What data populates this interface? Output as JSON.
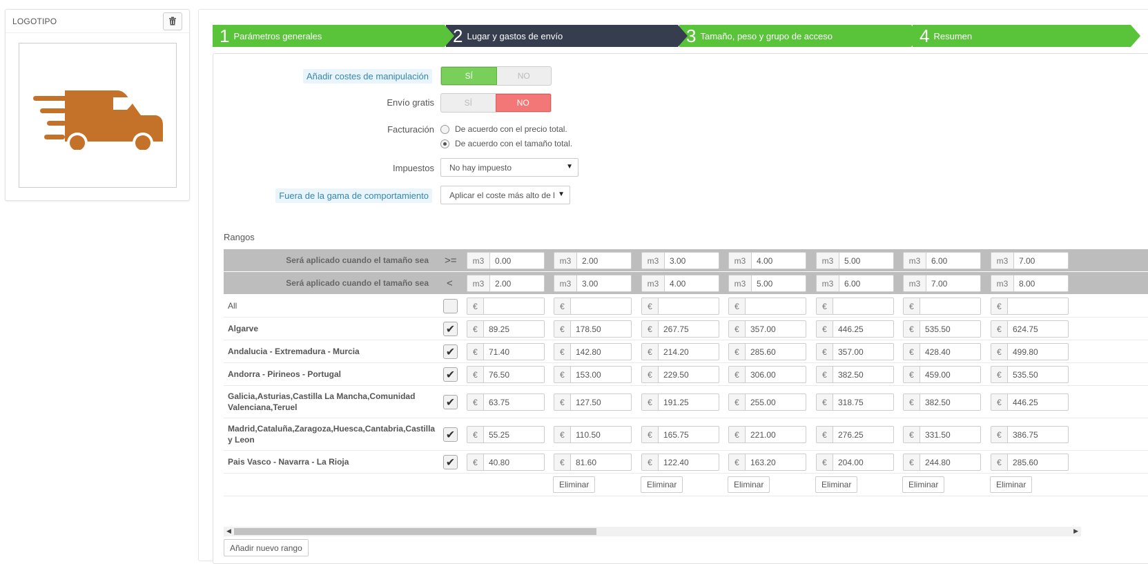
{
  "logo_panel": {
    "title": "LOGOTIPO",
    "delete_icon": "trash-icon",
    "image_icon": "delivery-van-icon",
    "van_color": "#c4722a"
  },
  "wizard": {
    "steps": [
      {
        "num": "1",
        "label": "Parámetros generales",
        "state": "done"
      },
      {
        "num": "2",
        "label": "Lugar y gastos de envío",
        "state": "active"
      },
      {
        "num": "3",
        "label": "Tamaño, peso y grupo de acceso",
        "state": "done"
      },
      {
        "num": "4",
        "label": "Resumen",
        "state": "done"
      }
    ],
    "colors": {
      "green": "#59c33a",
      "dark": "#353d4e"
    }
  },
  "form": {
    "handling": {
      "label": "Añadir costes de manipulación",
      "yes": "SÍ",
      "no": "NO",
      "value": "yes"
    },
    "free_shipping": {
      "label": "Envío gratis",
      "yes": "SÍ",
      "no": "NO",
      "value": "no"
    },
    "billing": {
      "label": "Facturación",
      "options": [
        {
          "label": "De acuerdo con el precio total.",
          "checked": false
        },
        {
          "label": "De acuerdo con el tamaño total.",
          "checked": true
        }
      ]
    },
    "tax": {
      "label": "Impuestos",
      "value": "No hay impuesto"
    },
    "out_of_range": {
      "label": "Fuera de la gama de comportamiento",
      "value": "Aplicar el coste más alto de l"
    }
  },
  "ranges": {
    "title": "Rangos",
    "ge_label": "Será aplicado cuando el tamaño sea",
    "ge_op": ">=",
    "lt_label": "Será aplicado cuando el tamaño sea",
    "lt_op": "<",
    "unit": "m3",
    "currency": "€",
    "from": [
      "0.00",
      "2.00",
      "3.00",
      "4.00",
      "5.00",
      "6.00",
      "7.00"
    ],
    "to": [
      "2.00",
      "3.00",
      "4.00",
      "5.00",
      "6.00",
      "7.00",
      "8.00"
    ],
    "all_label": "All",
    "zones": [
      {
        "name": "Algarve",
        "values": [
          "89.25",
          "178.50",
          "267.75",
          "357.00",
          "446.25",
          "535.50",
          "624.75"
        ]
      },
      {
        "name": "Andalucia - Extremadura - Murcia",
        "values": [
          "71.40",
          "142.80",
          "214.20",
          "285.60",
          "357.00",
          "428.40",
          "499.80"
        ]
      },
      {
        "name": "Andorra - Pirineos - Portugal",
        "values": [
          "76.50",
          "153.00",
          "229.50",
          "306.00",
          "382.50",
          "459.00",
          "535.50"
        ]
      },
      {
        "name": "Galicia,Asturias,Castilla La Mancha,Comunidad Valenciana,Teruel",
        "values": [
          "63.75",
          "127.50",
          "191.25",
          "255.00",
          "318.75",
          "382.50",
          "446.25"
        ]
      },
      {
        "name": "Madrid,Cataluña,Zaragoza,Huesca,Cantabria,Castilla y Leon",
        "values": [
          "55.25",
          "110.50",
          "165.75",
          "221.00",
          "276.25",
          "331.50",
          "386.75"
        ]
      },
      {
        "name": "Pais Vasco - Navarra - La Rioja",
        "values": [
          "40.80",
          "81.60",
          "122.40",
          "163.20",
          "204.00",
          "244.80",
          "285.60"
        ]
      }
    ],
    "delete_label": "Eliminar",
    "add_label": "Añadir nuevo rango"
  }
}
